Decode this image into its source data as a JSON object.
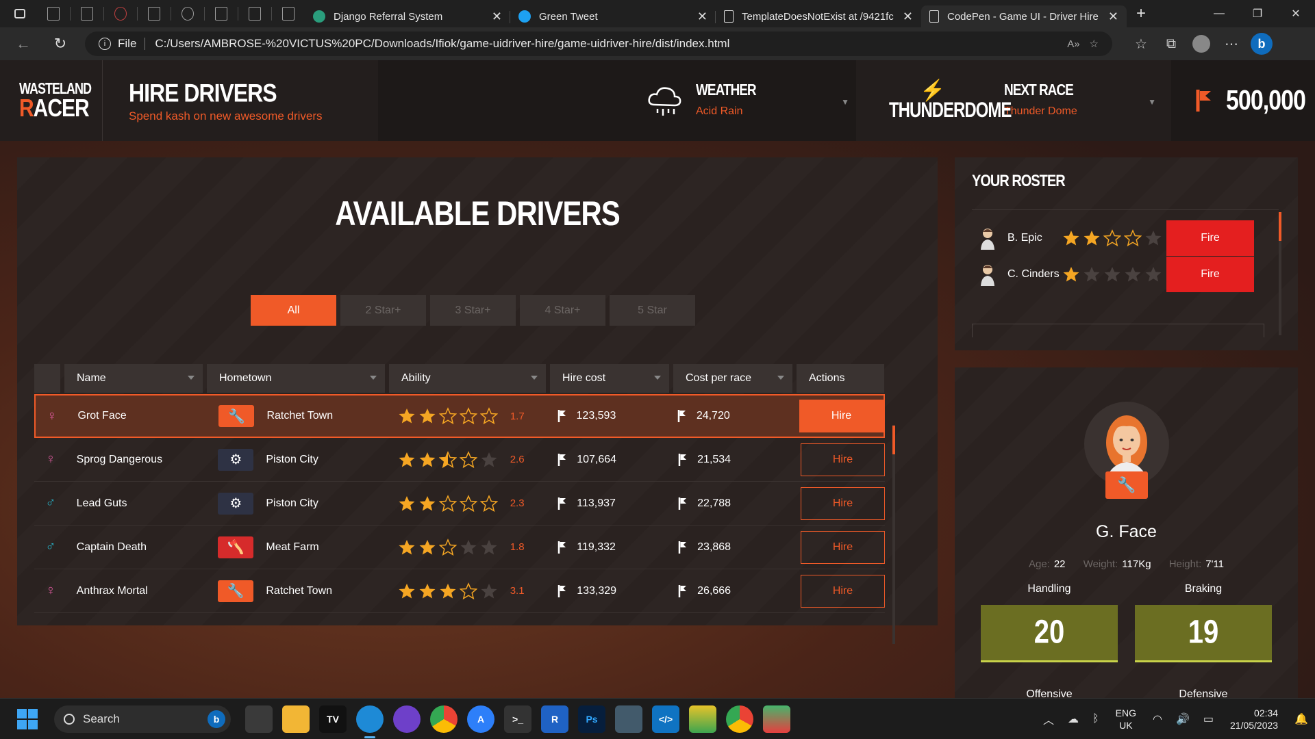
{
  "browser": {
    "tabs": [
      {
        "title": "Django Referral System",
        "fav_color": "#2a9d7c",
        "active": false
      },
      {
        "title": "Green Tweet",
        "fav_color": "#1da1f2",
        "active": false
      },
      {
        "title": "TemplateDoesNotExist at /9421fc",
        "fav_color": "#dddddd",
        "active": false
      },
      {
        "title": "CodePen - Game UI - Driver Hire",
        "fav_color": "#dddddd",
        "active": true
      }
    ],
    "url_scheme": "File",
    "url": "C:/Users/AMBROSE-%20VICTUS%20PC/Downloads/Ifiok/game-uidriver-hire/game-uidriver-hire/dist/index.html"
  },
  "header": {
    "logo_line1": "WASTELAND",
    "logo_line2_a": "R",
    "logo_line2_b": "ACER",
    "title": "HIRE DRIVERS",
    "subtitle": "Spend kash on new awesome drivers",
    "weather_label": "WEATHER",
    "weather_value": "Acid Rain",
    "race_logo": "THUNDERDOME",
    "next_race_label": "NEXT RACE",
    "next_race_value": "Thunder Dome",
    "money": "500,000"
  },
  "drivers": {
    "title": "AVAILABLE DRIVERS",
    "filters": [
      "All",
      "2 Star+",
      "3 Star+",
      "4 Star+",
      "5 Star"
    ],
    "active_filter": 0,
    "columns": [
      "Name",
      "Hometown",
      "Ability",
      "Hire cost",
      "Cost per race",
      "Actions"
    ],
    "rows": [
      {
        "sex": "♀",
        "sex_color": "#e05aa0",
        "name": "Grot Face",
        "town": "Ratchet Town",
        "badge": "orange",
        "badge_icon": "🔧",
        "stars": [
          1,
          1,
          0,
          0,
          0
        ],
        "ability": "1.7",
        "hire": "123,593",
        "per_race": "24,720",
        "action": "Hire",
        "selected": true
      },
      {
        "sex": "♀",
        "sex_color": "#e05aa0",
        "name": "Sprog Dangerous",
        "town": "Piston City",
        "badge": "dark",
        "badge_icon": "⚙",
        "stars": [
          1,
          1,
          0.5,
          0,
          -1
        ],
        "ability": "2.6",
        "hire": "107,664",
        "per_race": "21,534",
        "action": "Hire",
        "selected": false
      },
      {
        "sex": "♂",
        "sex_color": "#2ab3c8",
        "name": "Lead Guts",
        "town": "Piston City",
        "badge": "dark",
        "badge_icon": "⚙",
        "stars": [
          1,
          1,
          0,
          0,
          0
        ],
        "ability": "2.3",
        "hire": "113,937",
        "per_race": "22,788",
        "action": "Hire",
        "selected": false
      },
      {
        "sex": "♂",
        "sex_color": "#2ab3c8",
        "name": "Captain Death",
        "town": "Meat Farm",
        "badge": "red",
        "badge_icon": "🪓",
        "stars": [
          1,
          1,
          0,
          -1,
          -1
        ],
        "ability": "1.8",
        "hire": "119,332",
        "per_race": "23,868",
        "action": "Hire",
        "selected": false
      },
      {
        "sex": "♀",
        "sex_color": "#e05aa0",
        "name": "Anthrax Mortal",
        "town": "Ratchet Town",
        "badge": "orange",
        "badge_icon": "🔧",
        "stars": [
          1,
          1,
          1,
          0,
          -1
        ],
        "ability": "3.1",
        "hire": "133,329",
        "per_race": "26,666",
        "action": "Hire",
        "selected": false
      }
    ]
  },
  "roster": {
    "title": "YOUR ROSTER",
    "items": [
      {
        "name": "B. Epic",
        "stars": [
          1,
          1,
          0,
          0,
          -1
        ],
        "action": "Fire"
      },
      {
        "name": "C. Cinders",
        "stars": [
          1,
          -1,
          -1,
          -1,
          -1
        ],
        "action": "Fire"
      }
    ]
  },
  "profile": {
    "name": "G. Face",
    "age_label": "Age:",
    "age": "22",
    "weight_label": "Weight:",
    "weight": "117Kg",
    "height_label": "Height:",
    "height": "7'11",
    "skills": [
      {
        "label": "Handling",
        "value": "20"
      },
      {
        "label": "Braking",
        "value": "19"
      },
      {
        "label": "Offensive",
        "value": ""
      },
      {
        "label": "Defensive",
        "value": ""
      }
    ]
  },
  "taskbar": {
    "search_placeholder": "Search",
    "lang_line1": "ENG",
    "lang_line2": "UK",
    "time": "02:34",
    "date": "21/05/2023"
  },
  "colors": {
    "accent": "#f05a28",
    "fire": "#e41f1f",
    "skill": "#6b6e22"
  }
}
